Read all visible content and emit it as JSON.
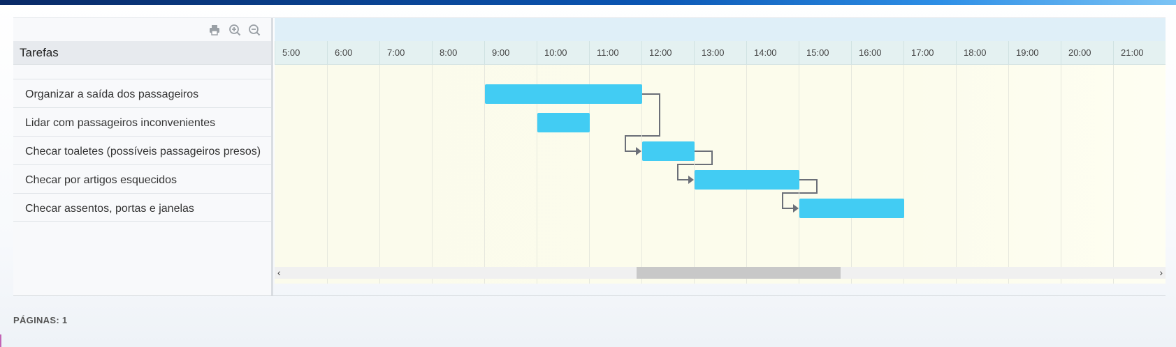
{
  "toolbar": {
    "print_icon": "print-icon",
    "zoom_in_icon": "zoom-in-icon",
    "zoom_out_icon": "zoom-out-icon"
  },
  "grid": {
    "header": "Tarefas",
    "tasks": [
      "Organizar a saída dos passageiros",
      "Lidar com passageiros inconvenientes",
      "Checar toaletes (possíveis passageiros presos)",
      "Checar por artigos esquecidos",
      "Checar assentos, portas e janelas"
    ]
  },
  "timescale": {
    "hours": [
      "5:00",
      "6:00",
      "7:00",
      "8:00",
      "9:00",
      "10:00",
      "11:00",
      "12:00",
      "13:00",
      "14:00",
      "15:00",
      "16:00",
      "17:00",
      "18:00",
      "19:00",
      "20:00",
      "21:00"
    ]
  },
  "bars": [
    {
      "task": "Organizar a saída dos passageiros",
      "start": "9:00",
      "end": "12:00"
    },
    {
      "task": "Lidar com passageiros inconvenientes",
      "start": "10:00",
      "end": "11:00"
    },
    {
      "task": "Checar toaletes (possíveis passageiros presos)",
      "start": "12:00",
      "end": "13:00"
    },
    {
      "task": "Checar por artigos esquecidos",
      "start": "13:00",
      "end": "15:00"
    },
    {
      "task": "Checar assentos, portas e janelas",
      "start": "15:00",
      "end": "17:00"
    }
  ],
  "dependencies": [
    {
      "from": "Organizar a saída dos passageiros",
      "to": "Checar toaletes (possíveis passageiros presos)"
    },
    {
      "from": "Checar toaletes (possíveis passageiros presos)",
      "to": "Checar por artigos esquecidos"
    },
    {
      "from": "Checar por artigos esquecidos",
      "to": "Checar assentos, portas e janelas"
    }
  ],
  "scroll": {
    "left_arrow": "‹",
    "right_arrow": "›"
  },
  "footer": {
    "pages_label": "PÁGINAS:",
    "pages_value": "1"
  },
  "colors": {
    "bar": "#42ccf3",
    "link": "#6b6f78"
  }
}
